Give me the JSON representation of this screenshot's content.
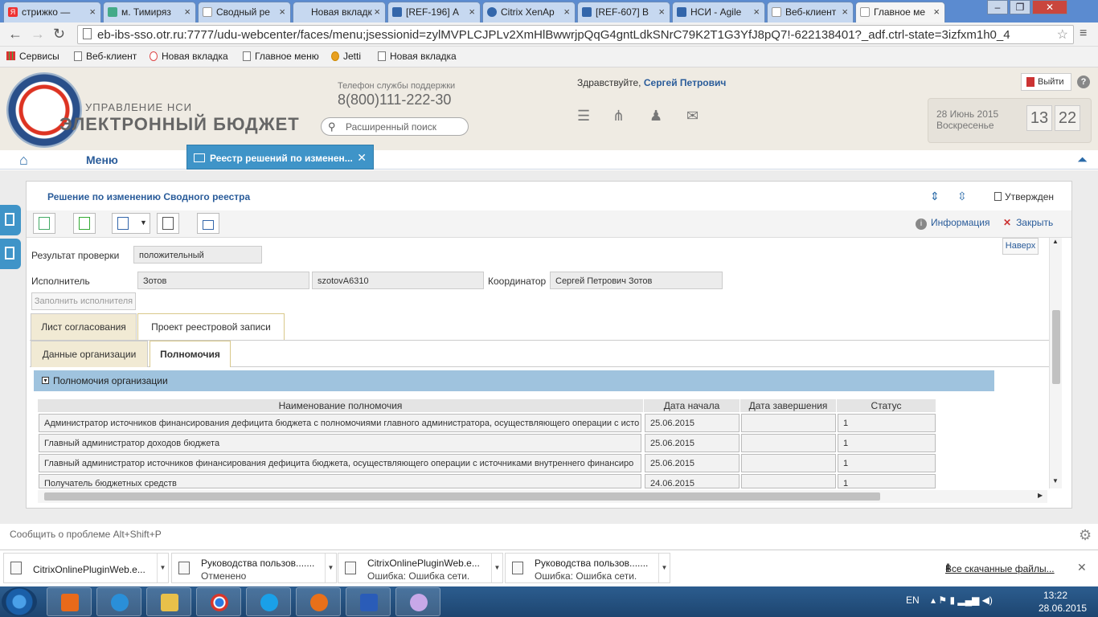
{
  "browser": {
    "tabs": [
      {
        "label": "стрижко —",
        "icon": "yandex-icon",
        "color": "#e33"
      },
      {
        "label": "м. Тимиряз",
        "icon": "map-icon",
        "color": "#4a8"
      },
      {
        "label": "Сводный ре",
        "icon": "page-icon",
        "color": "#999"
      },
      {
        "label": "Новая вкладк",
        "icon": "page-icon",
        "color": "#999"
      },
      {
        "label": "[REF-196] А",
        "icon": "jira-icon",
        "color": "#36a"
      },
      {
        "label": "Citrix XenAp",
        "icon": "citrix-icon",
        "color": "#36a"
      },
      {
        "label": "[REF-607] В",
        "icon": "jira-icon",
        "color": "#36a"
      },
      {
        "label": "НСИ - Agile",
        "icon": "jira-icon",
        "color": "#36a"
      },
      {
        "label": "Веб-клиент",
        "icon": "page-icon",
        "color": "#999"
      },
      {
        "label": "Главное ме",
        "icon": "page-icon",
        "color": "#999"
      }
    ],
    "url": "eb-ibs-sso.otr.ru:7777/udu-webcenter/faces/menu;jsessionid=zylMVPLCJPLv2XmHlBwwrjpQqG4gntLdkSNrC79K2T1G3YfJ8pQ7!-622138401?_adf.ctrl-state=3izfxm1h0_4",
    "bookmarks": [
      {
        "label": "Сервисы",
        "icon": "apps-icon"
      },
      {
        "label": "Веб-клиент",
        "icon": "page-icon"
      },
      {
        "label": "Новая вкладка",
        "icon": "page-icon"
      },
      {
        "label": "Главное меню",
        "icon": "page-icon"
      },
      {
        "label": "Jetti",
        "icon": "jetti-icon"
      },
      {
        "label": "Новая вкладка",
        "icon": "page-icon"
      }
    ]
  },
  "header": {
    "brand_top": "УПРАВЛЕНИЕ НСИ",
    "brand_main": "ЭЛЕКТРОННЫЙ БЮДЖЕТ",
    "support_label": "Телефон службы поддержки",
    "support_phone": "8(800)111-222-30",
    "search_placeholder": "Расширенный поиск",
    "greeting": "Здравствуйте,",
    "user_name": "Сергей Петрович",
    "logout_label": "Выйти",
    "date": "28 Июнь 2015",
    "weekday": "Воскресенье",
    "hour": "13",
    "minute": "22"
  },
  "menubar": {
    "menu_label": "Меню",
    "doc_tab_label": "Реестр решений по изменен..."
  },
  "panel": {
    "title": "Решение по изменению Сводного реестра",
    "status": "Утвержден",
    "info_label": "Информация",
    "close_label": "Закрыть",
    "top_label": "Наверх"
  },
  "form": {
    "check_result_label": "Результат проверки",
    "check_result_value": "положительный",
    "executor_label": "Исполнитель",
    "executor_name": "Зотов",
    "executor_login": "szotovA6310",
    "coordinator_label": "Координатор",
    "coordinator_value": "Сергей Петрович Зотов",
    "fill_executor_label": "Заполнить исполнителя",
    "outer_tabs": [
      "Лист согласования",
      "Проект реестровой записи"
    ],
    "inner_tabs": [
      "Данные организации",
      "Полномочия"
    ],
    "section_title": "Полномочия организации"
  },
  "table": {
    "headers": [
      "Наименование полномочия",
      "Дата начала",
      "Дата завершения",
      "Статус"
    ],
    "rows": [
      {
        "name": "Администратор источников финансирования дефицита бюджета с полномочиями главного администратора, осуществляющего операции с исто",
        "start": "25.06.2015",
        "end": "",
        "status": "1"
      },
      {
        "name": "Главный администратор доходов бюджета",
        "start": "25.06.2015",
        "end": "",
        "status": "1"
      },
      {
        "name": "Главный администратор источников финансирования дефицита бюджета, осуществляющего операции с источниками внутреннего финансиро",
        "start": "25.06.2015",
        "end": "",
        "status": "1"
      },
      {
        "name": "Получатель бюджетных средств",
        "start": "24.06.2015",
        "end": "",
        "status": "1"
      }
    ]
  },
  "footer": {
    "report_label": "Сообщить о проблеме Alt+Shift+P"
  },
  "downloads": {
    "items": [
      {
        "name": "CitrixOnlinePluginWeb.e...",
        "status": ""
      },
      {
        "name": "Руководства пользов.......",
        "status": "Отменено"
      },
      {
        "name": "CitrixOnlinePluginWeb.e...",
        "status": "Ошибка: Ошибка сети."
      },
      {
        "name": "Руководства пользов.......",
        "status": "Ошибка: Ошибка сети."
      }
    ],
    "all_label": "Все скачанные файлы..."
  },
  "taskbar": {
    "lang": "EN",
    "time": "13:22",
    "date": "28.06.2015",
    "apps": [
      {
        "icon": "media-player-icon",
        "color": "#e86a1a"
      },
      {
        "icon": "ie-icon",
        "color": "#2a8fd8"
      },
      {
        "icon": "explorer-icon",
        "color": "#e8c04a"
      },
      {
        "icon": "chrome-icon",
        "color": "#d9352a"
      },
      {
        "icon": "skype-icon",
        "color": "#1aa0e8"
      },
      {
        "icon": "firefox-icon",
        "color": "#e8701a"
      },
      {
        "icon": "word-icon",
        "color": "#2a5cb8"
      },
      {
        "icon": "paint-icon",
        "color": "#c8a8e8"
      }
    ]
  }
}
